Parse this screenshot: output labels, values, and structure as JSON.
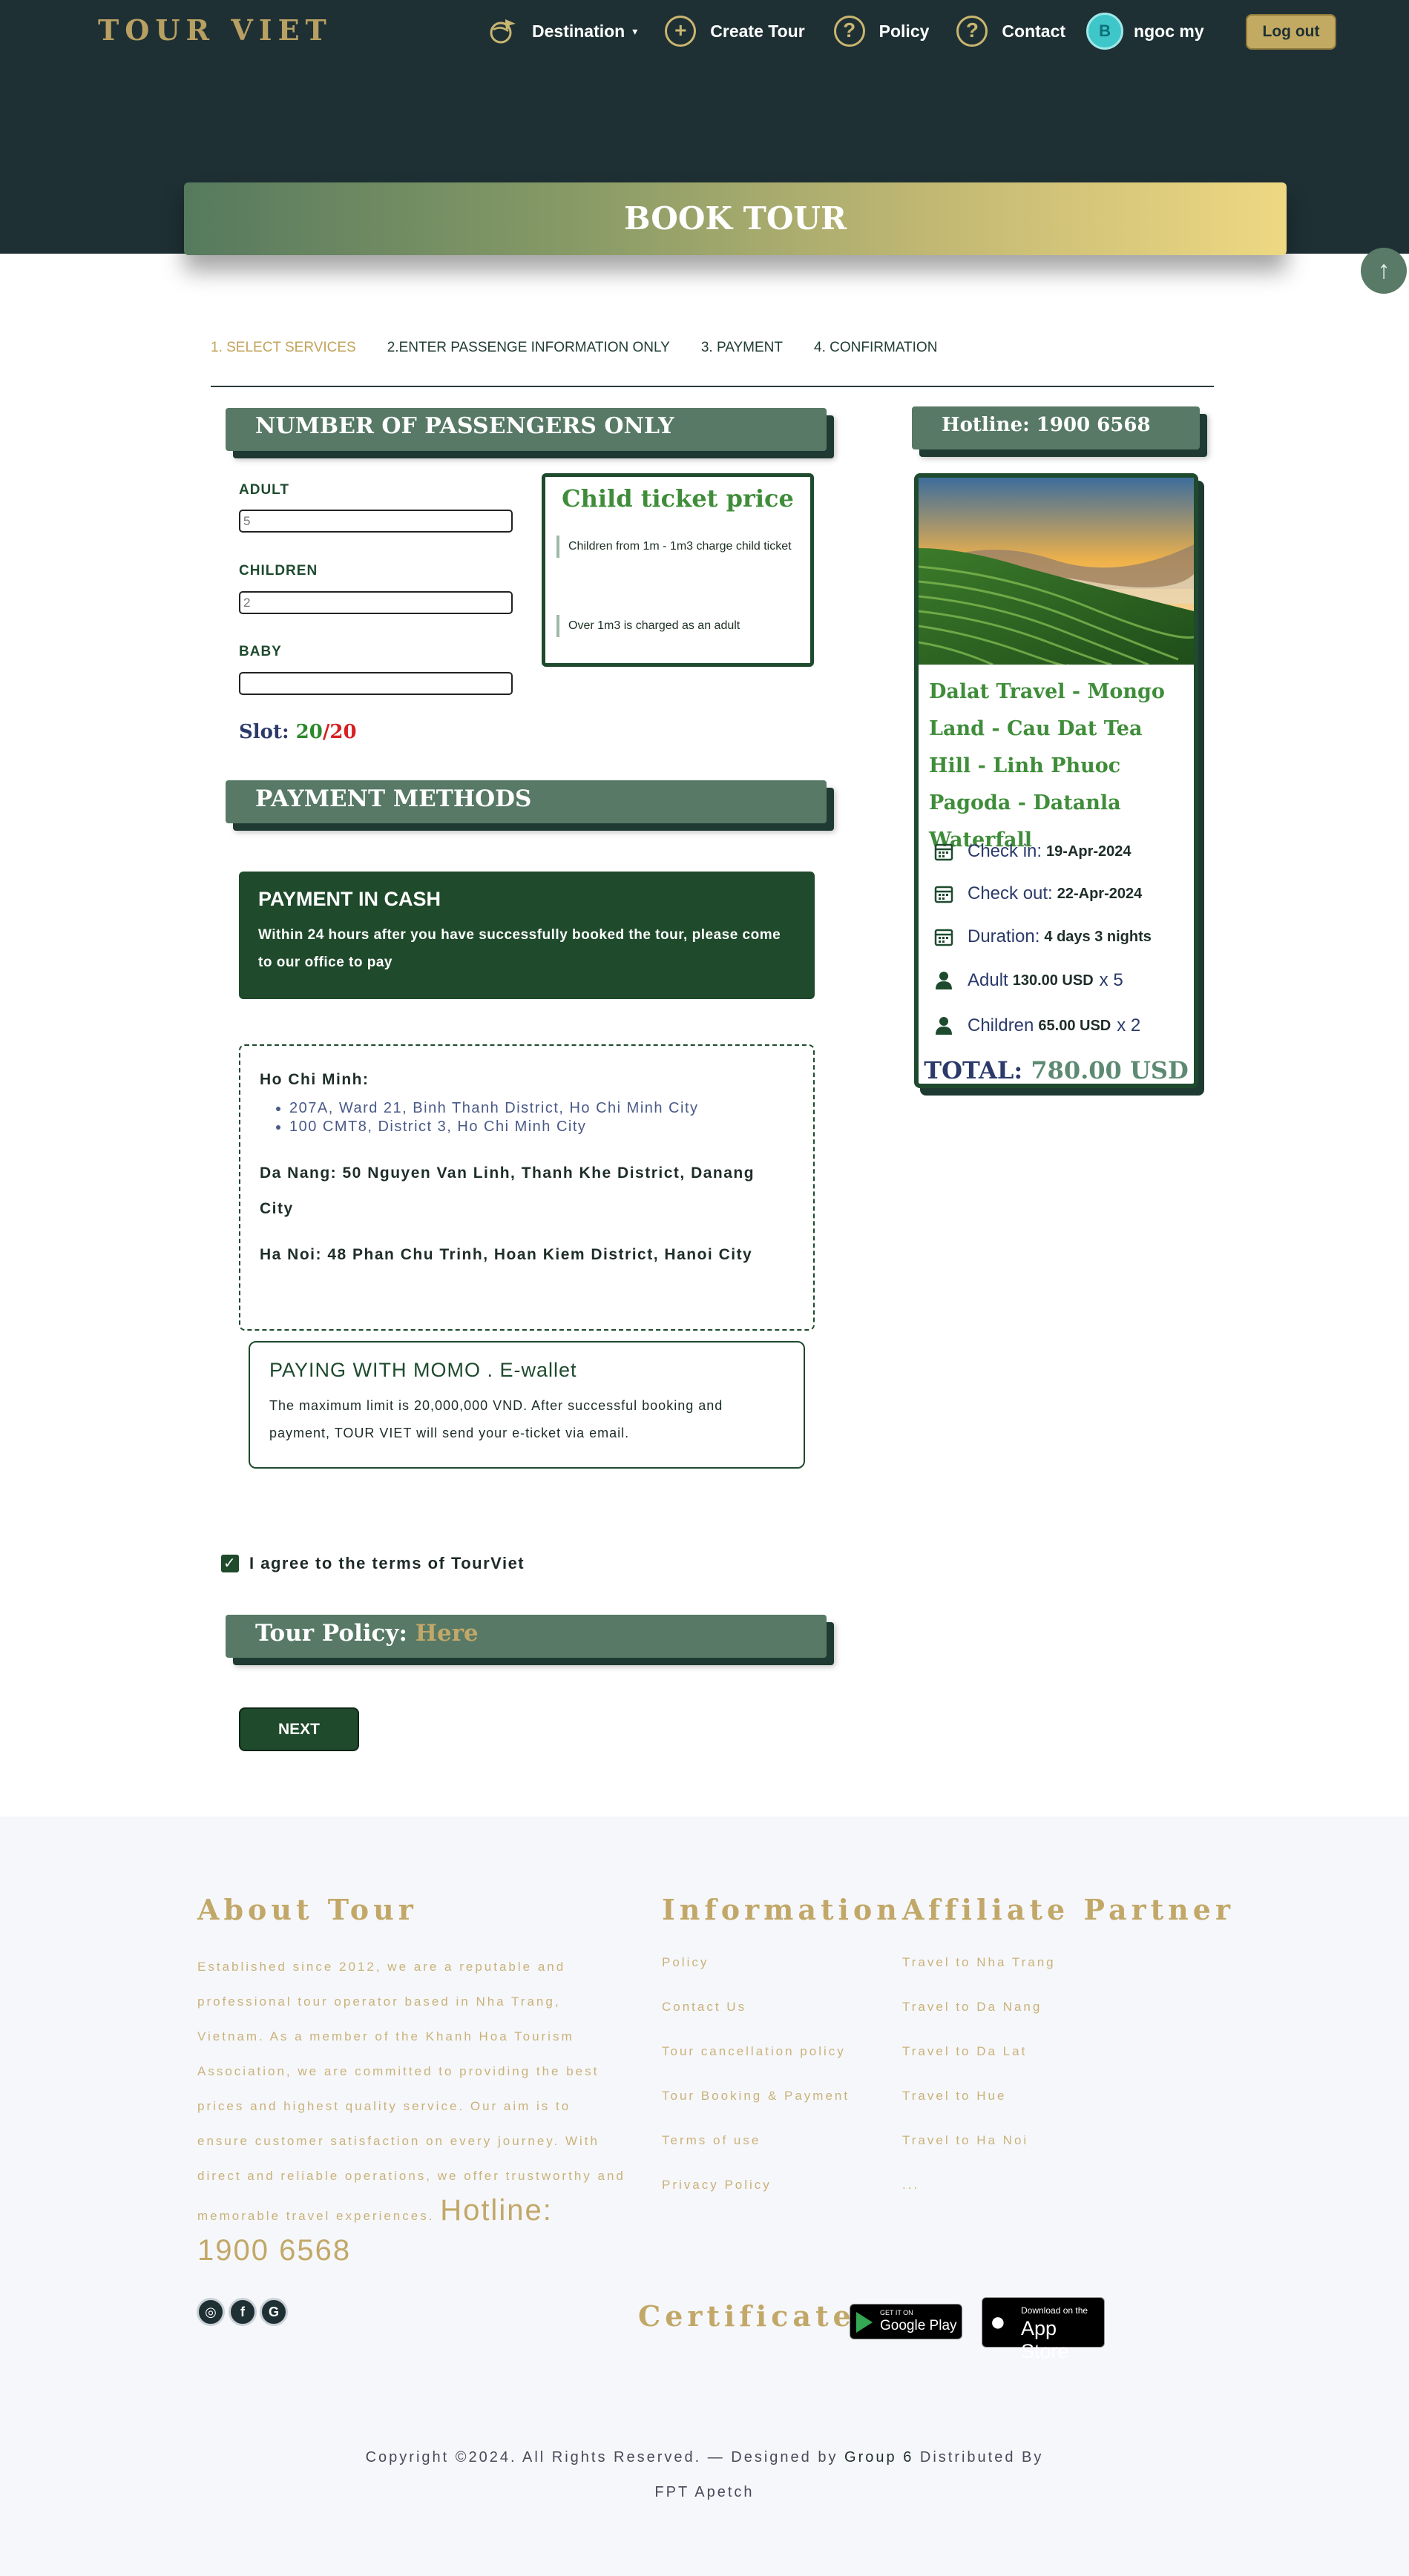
{
  "header": {
    "logo": "TOUR VIET",
    "nav": {
      "destination": "Destination",
      "create_tour": "Create Tour",
      "policy": "Policy",
      "contact": "Contact",
      "user_name": "ngoc my",
      "logout": "Log out"
    },
    "banner_title": "BOOK TOUR"
  },
  "steps": [
    "1. SELECT SERVICES",
    "2.ENTER PASSENGE INFORMATION ONLY",
    "3. PAYMENT",
    "4. CONFIRMATION"
  ],
  "passengers": {
    "section_title": "NUMBER OF PASSENGERS ONLY",
    "adult_label": "ADULT",
    "adult_value": "5",
    "children_label": "CHILDREN",
    "children_value": "2",
    "baby_label": "BABY",
    "baby_value": "",
    "slot_label": "Slot:",
    "slot_used": "20",
    "slot_total": "/20"
  },
  "child_ticket": {
    "title": "Child ticket price",
    "note1": "Children from 1m - 1m3 charge child ticket",
    "note2": "Over 1m3 is charged as an adult"
  },
  "payment": {
    "section_title": "PAYMENT METHODS",
    "cash_title": "PAYMENT IN CASH",
    "cash_text": "Within 24 hours after you have successfully booked the tour, please come to our office to pay",
    "hcm_label": "Ho Chi Minh:",
    "hcm_address1": "207A, Ward 21, Binh Thanh District, Ho Chi Minh City",
    "hcm_address2": "100 CMT8, District 3, Ho Chi Minh City",
    "danang": "Da Nang: 50 Nguyen Van Linh, Thanh Khe District, Danang City",
    "hanoi": "Ha Noi: 48 Phan Chu Trinh, Hoan Kiem District, Hanoi City",
    "momo_title": "PAYING WITH MOMO . E-wallet",
    "momo_text": "The maximum limit is 20,000,000 VND. After successful booking and payment, TOUR VIET will send your e-ticket via email."
  },
  "agree_text": "I agree to the terms of TourViet",
  "policy": {
    "label": "Tour Policy:",
    "link": "Here"
  },
  "next_button": "NEXT",
  "summary": {
    "hotline": "Hotline: 1900 6568",
    "tour_name": "Dalat Travel - Mongo Land - Cau Dat Tea Hill - Linh Phuoc Pagoda - Datanla Waterfall",
    "checkin_label": "Check in:",
    "checkin": "19-Apr-2024",
    "checkout_label": "Check out:",
    "checkout": "22-Apr-2024",
    "duration_label": "Duration:",
    "duration": "4 days 3 nights",
    "adult_label": "Adult",
    "adult_price": "130.00 USD",
    "adult_qty": "x 5",
    "children_label": "Children",
    "children_price": "65.00 USD",
    "children_qty": "x 2",
    "total_label": "TOTAL:",
    "total": "780.00 USD"
  },
  "footer": {
    "about_title": "About Tour",
    "about_text": "Established since 2012, we are a reputable and professional tour operator based in Nha Trang, Vietnam. As a member of the Khanh Hoa Tourism Association, we are committed to providing the best prices and highest quality service. Our aim is to ensure customer satisfaction on every journey. With direct and reliable operations, we offer trustworthy and memorable travel experiences.",
    "hotline": "Hotline: 1900 6568",
    "info_title": "Information",
    "info_links": [
      "Policy",
      "Contact Us",
      "Tour cancellation policy",
      "Tour Booking & Payment",
      "Terms of use",
      "Privacy Policy"
    ],
    "partner_title": "Affiliate Partner",
    "partner_links": [
      "Travel to Nha Trang",
      "Travel to Da Nang",
      "Travel to Da Lat",
      "Travel to Hue",
      "Travel to Ha Noi",
      "..."
    ],
    "certificate_title": "Certificate",
    "google_play_small": "GET IT ON",
    "google_play": "Google Play",
    "app_store_small": "Download on the",
    "app_store": "App Store",
    "copyright_prefix": "Copyright ©2024. All Rights Reserved. — Designed by",
    "copyright_group": "Group 6",
    "copyright_suffix": "Distributed By",
    "copyright_company": "FPT Apetch"
  },
  "colors": {
    "header_bg": "#1e3034",
    "gold": "#c2a868",
    "dark_green": "#1f4a2b",
    "section_green": "#577966"
  }
}
